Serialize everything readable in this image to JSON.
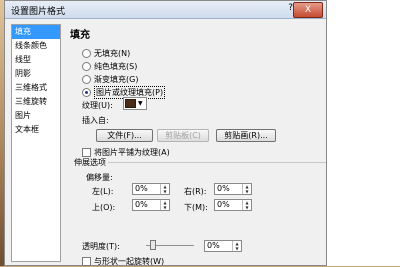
{
  "window": {
    "title": "设置图片格式",
    "help": "?",
    "close": "X"
  },
  "sidebar": {
    "items": [
      {
        "label": "填充"
      },
      {
        "label": "线条颜色"
      },
      {
        "label": "线型"
      },
      {
        "label": "阴影"
      },
      {
        "label": "三维格式"
      },
      {
        "label": "三维旋转"
      },
      {
        "label": "图片"
      },
      {
        "label": "文本框"
      }
    ]
  },
  "fill": {
    "heading": "填充",
    "options": [
      {
        "label": "无填充(N)"
      },
      {
        "label": "纯色填充(S)"
      },
      {
        "label": "渐变填充(G)"
      },
      {
        "label": "图片或纹理填充(P)"
      }
    ],
    "texture_label": "纹理(U):",
    "insert_from_label": "插入自:",
    "file_btn": "文件(F)...",
    "clipboard_btn": "剪贴板(C)",
    "clipart_btn": "剪贴画(R)...",
    "tile_checkbox": "将图片平铺为纹理(A)",
    "stretch_options": "伸展选项",
    "offsets_label": "偏移量:",
    "left_label": "左(L):",
    "left_value": "0%",
    "right_label": "右(R):",
    "right_value": "0%",
    "top_label": "上(O):",
    "top_value": "0%",
    "bottom_label": "下(M):",
    "bottom_value": "0%",
    "transparency_label": "透明度(T):",
    "transparency_value": "0%",
    "rotate_checkbox": "与形状一起旋转(W)"
  }
}
